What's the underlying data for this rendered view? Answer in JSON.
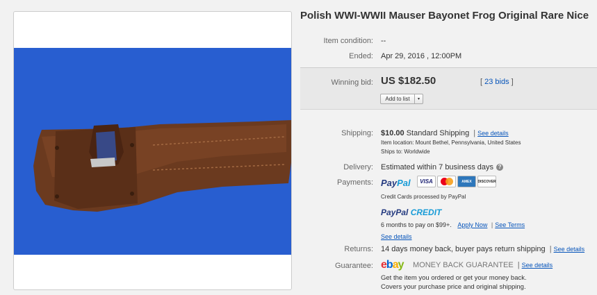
{
  "title": "Polish WWI-WWII Mauser Bayonet Frog Original Rare Nice",
  "condition": {
    "label": "Item condition:",
    "value": "--"
  },
  "ended": {
    "label": "Ended:",
    "value": "Apr 29, 2016 , 12:00PM"
  },
  "bid": {
    "label": "Winning bid:",
    "price": "US $182.50",
    "bids_open": "[",
    "bids_text": "23 bids",
    "bids_close": "]",
    "add_to_list": "Add to list",
    "dropdown_glyph": "▾"
  },
  "shipping": {
    "label": "Shipping:",
    "cost": "$10.00",
    "method": "Standard Shipping",
    "separator": "|",
    "details_link": "See details",
    "location": "Item location:  Mount Bethel, Pennsylvania, United States",
    "ships_to": "Ships to:  Worldwide"
  },
  "delivery": {
    "label": "Delivery:",
    "value": "Estimated within 7 business days",
    "help_glyph": "?"
  },
  "payments": {
    "label": "Payments:",
    "paypal_a": "Pay",
    "paypal_b": "Pal",
    "cards": [
      "VISA",
      "MasterCard",
      "AMERICAN EXPRESS",
      "DISCOVER"
    ],
    "processed_note": "Credit Cards processed by PayPal",
    "credit_a": "PayPal",
    "credit_b": "CREDIT",
    "credit_terms": "6 months to pay on $99+.",
    "apply_link": "Apply Now",
    "sep": "|",
    "terms_link": "See Terms",
    "details_link": "See details"
  },
  "returns": {
    "label": "Returns:",
    "value": "14 days money back, buyer pays return shipping",
    "sep": "|",
    "details_link": "See details"
  },
  "guarantee": {
    "label": "Guarantee:",
    "ebay_letters": [
      "e",
      "b",
      "a",
      "y"
    ],
    "mbg": "MONEY BACK GUARANTEE",
    "sep": "|",
    "details_link": "See details",
    "line1": "Get the item you ordered or get your money back.",
    "line2": "Covers your purchase price and original shipping."
  },
  "colors": {
    "photo_background": "#2d63d6",
    "leather": "#6b3a1f",
    "link": "#0654ba",
    "bid_box": "#e8e8e8"
  }
}
